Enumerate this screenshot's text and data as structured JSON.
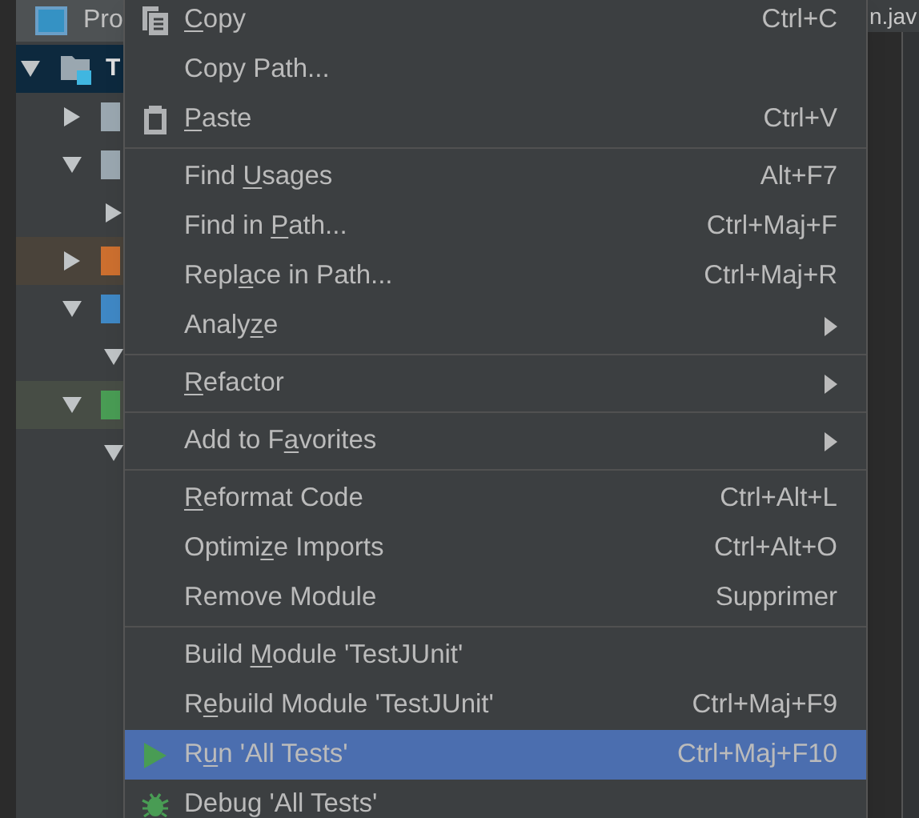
{
  "project_tab": {
    "label": "Pro"
  },
  "editor_tab": {
    "label": "n.jav"
  },
  "tree": [
    {
      "label": "T",
      "expanded": true,
      "selected": true,
      "kind": "module",
      "children": [
        {
          "expanded": false,
          "selected": false,
          "kind": "folder"
        },
        {
          "expanded": true,
          "selected": false,
          "kind": "folder",
          "children": [
            {
              "expanded": false,
              "selected": false
            }
          ]
        },
        {
          "expanded": false,
          "selected": false,
          "kind": "excluded"
        },
        {
          "expanded": true,
          "selected": false,
          "kind": "source",
          "children": [
            {
              "expanded": true,
              "selected": false
            }
          ]
        },
        {
          "expanded": true,
          "selected": false,
          "kind": "test",
          "children": [
            {
              "expanded": true,
              "selected": false
            }
          ]
        }
      ]
    }
  ],
  "menu": [
    {
      "kind": "copy",
      "key": "C",
      "post": "opy",
      "shortcut": "Ctrl+C",
      "submenu": false,
      "selected": false
    },
    {
      "kind": "item",
      "pre": "Copy Path...",
      "submenu": false,
      "selected": false
    },
    {
      "kind": "paste",
      "key": "P",
      "post": "aste",
      "shortcut": "Ctrl+V",
      "submenu": false,
      "selected": false
    },
    {
      "kind": "separator"
    },
    {
      "kind": "item",
      "pre": "Find ",
      "key": "U",
      "post": "sages",
      "shortcut": "Alt+F7",
      "submenu": false,
      "selected": false
    },
    {
      "kind": "item",
      "pre": "Find in ",
      "key": "P",
      "post": "ath...",
      "shortcut": "Ctrl+Maj+F",
      "submenu": false,
      "selected": false
    },
    {
      "kind": "item",
      "pre": "Repl",
      "key": "a",
      "post": "ce in Path...",
      "shortcut": "Ctrl+Maj+R",
      "submenu": false,
      "selected": false
    },
    {
      "kind": "item",
      "pre": "Analy",
      "key": "z",
      "post": "e",
      "submenu": true,
      "selected": false
    },
    {
      "kind": "separator"
    },
    {
      "kind": "item",
      "key": "R",
      "post": "efactor",
      "submenu": true,
      "selected": false
    },
    {
      "kind": "separator"
    },
    {
      "kind": "item",
      "pre": "Add to F",
      "key": "a",
      "post": "vorites",
      "submenu": true,
      "selected": false
    },
    {
      "kind": "separator"
    },
    {
      "kind": "item",
      "key": "R",
      "post": "eformat Code",
      "shortcut": "Ctrl+Alt+L",
      "submenu": false,
      "selected": false
    },
    {
      "kind": "item",
      "pre": "Optimi",
      "key": "z",
      "post": "e Imports",
      "shortcut": "Ctrl+Alt+O",
      "submenu": false,
      "selected": false
    },
    {
      "kind": "item",
      "pre": "Remove Module",
      "shortcut": "Supprimer",
      "submenu": false,
      "selected": false
    },
    {
      "kind": "separator"
    },
    {
      "kind": "item",
      "pre": "Build ",
      "key": "M",
      "post": "odule 'TestJUnit'",
      "submenu": false,
      "selected": false
    },
    {
      "kind": "item",
      "pre": "R",
      "key": "e",
      "post": "build Module 'TestJUnit'",
      "shortcut": "Ctrl+Maj+F9",
      "submenu": false,
      "selected": false
    },
    {
      "kind": "run",
      "pre": "R",
      "key": "u",
      "post": "n 'All Tests'",
      "shortcut": "Ctrl+Maj+F10",
      "submenu": false,
      "selected": true
    },
    {
      "kind": "debug",
      "pre": "Debug 'All Tests'",
      "submenu": false,
      "selected": false
    }
  ]
}
